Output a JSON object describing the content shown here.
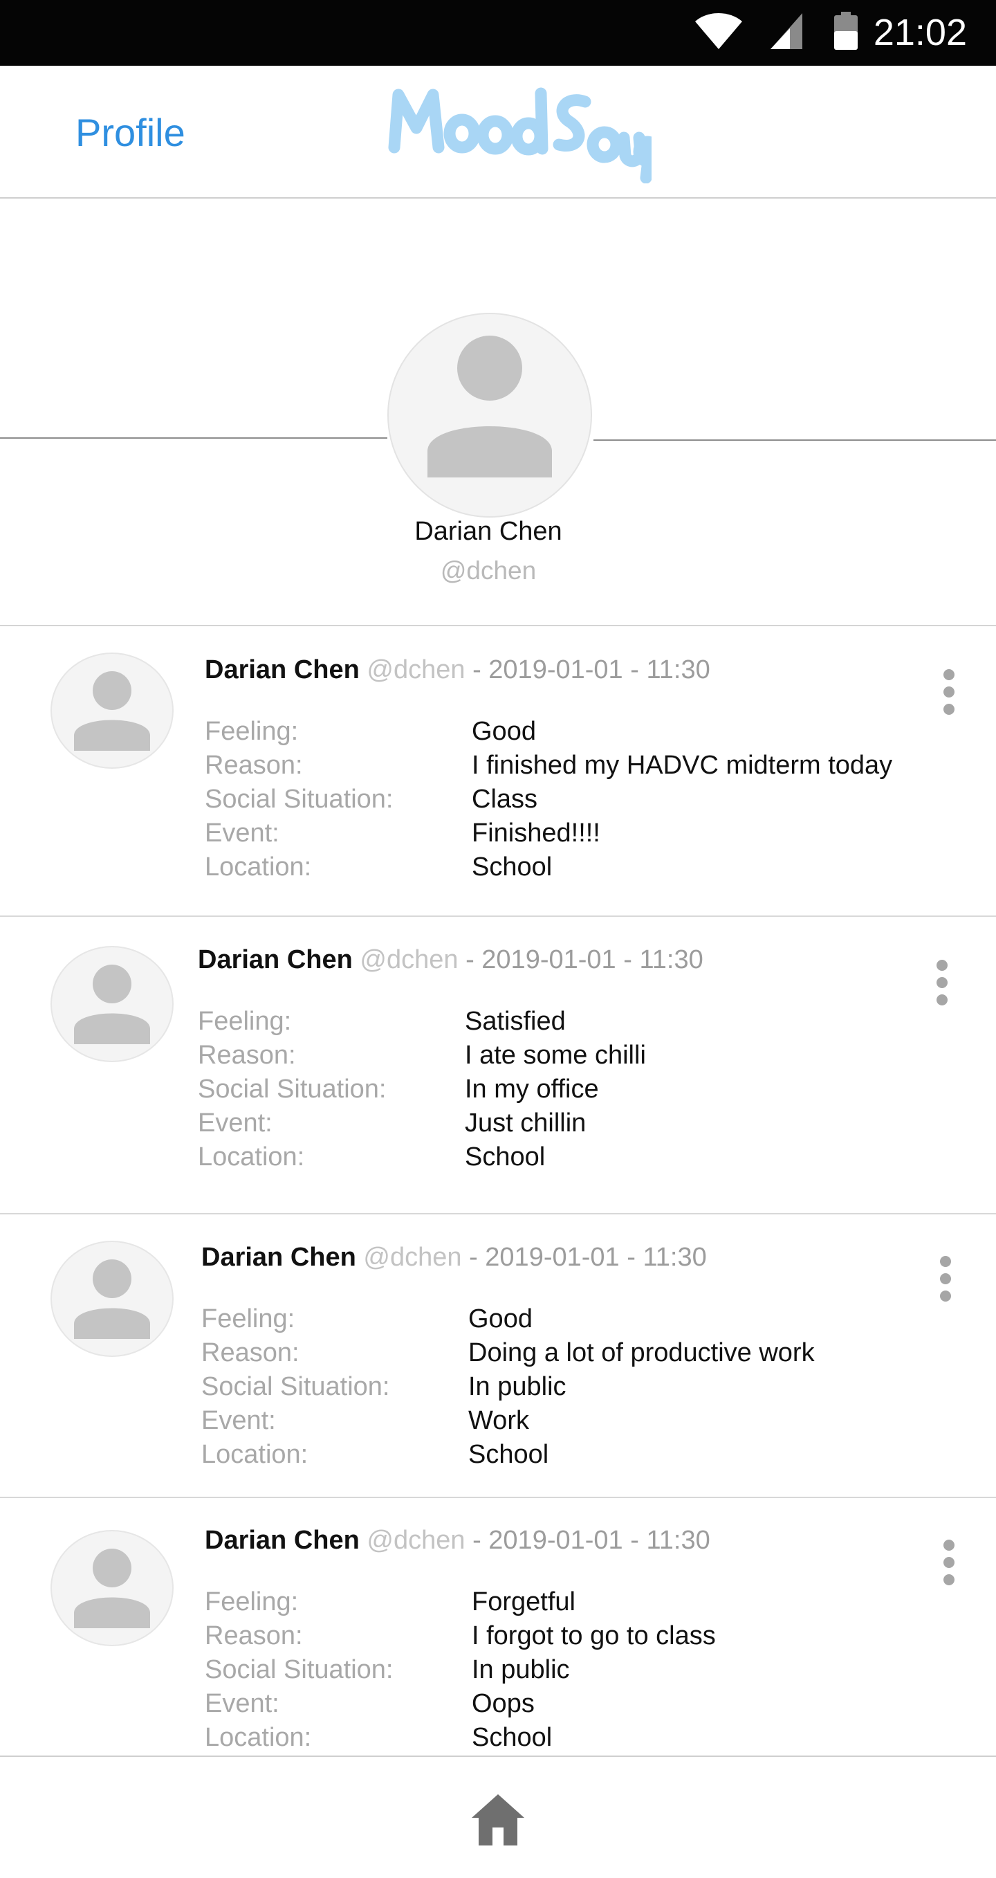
{
  "status_bar": {
    "time": "21:02",
    "icons": [
      "wifi-icon",
      "cell-signal-icon",
      "battery-icon"
    ]
  },
  "header": {
    "profile_link": "Profile",
    "logo_text": "MoodSoup",
    "accent_color": "#2f8fe0",
    "logo_color": "#a9d6f5"
  },
  "profile": {
    "name": "Darian Chen",
    "handle": "@dchen",
    "avatar_icon": "default-user-avatar-icon"
  },
  "field_labels": {
    "feeling": "Feeling:",
    "reason": "Reason:",
    "social": "Social Situation:",
    "event": "Event:",
    "location": "Location:"
  },
  "posts": [
    {
      "name": "Darian Chen",
      "handle": "@dchen",
      "date": "- 2019-01-01 - 11:30",
      "feeling": "Good",
      "reason": "I finished my HADVC midterm today",
      "social": "Class",
      "event": "Finished!!!!",
      "location": "School"
    },
    {
      "name": "Darian Chen",
      "handle": "@dchen",
      "date": "- 2019-01-01 - 11:30",
      "feeling": "Satisfied",
      "reason": "I ate some chilli",
      "social": "In my office",
      "event": "Just chillin",
      "location": "School"
    },
    {
      "name": "Darian Chen",
      "handle": "@dchen",
      "date": "- 2019-01-01 - 11:30",
      "feeling": "Good",
      "reason": "Doing a lot of productive work",
      "social": "In public",
      "event": "Work",
      "location": "School"
    },
    {
      "name": "Darian Chen",
      "handle": "@dchen",
      "date": "- 2019-01-01 - 11:30",
      "feeling": "Forgetful",
      "reason": "I forgot to go to class",
      "social": "In public",
      "event": "Oops",
      "location": "School"
    }
  ],
  "bottom_nav": {
    "home_icon": "home-icon"
  }
}
